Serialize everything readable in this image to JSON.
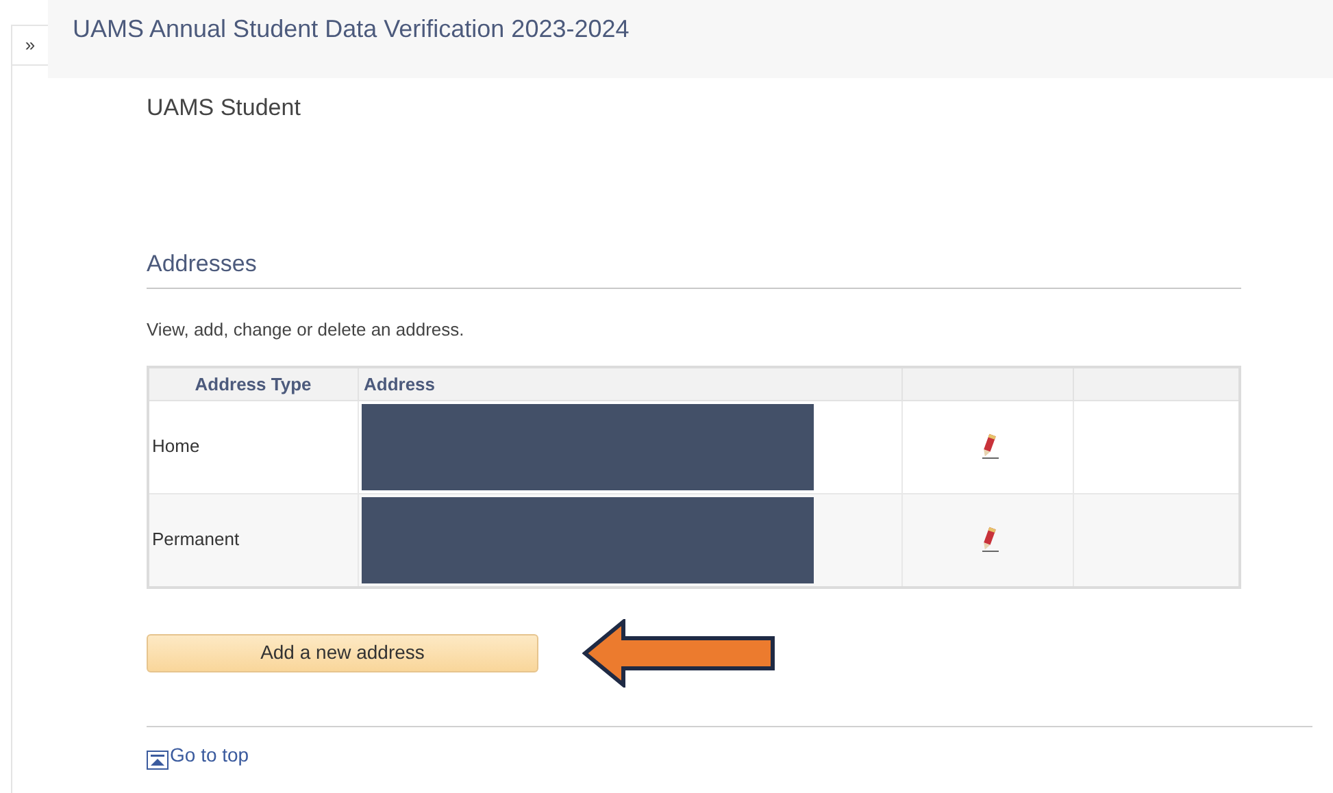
{
  "expand_button": {
    "label": "»"
  },
  "page_title": "UAMS Annual Student Data Verification 2023-2024",
  "subtitle": "UAMS Student",
  "section": {
    "heading": "Addresses",
    "description": "View, add, change or delete an address."
  },
  "table": {
    "columns": [
      "Address Type",
      "Address"
    ],
    "rows": [
      {
        "type": "Home"
      },
      {
        "type": "Permanent"
      }
    ]
  },
  "add_button": {
    "label": "Add a new address"
  },
  "go_to_top": {
    "label": "Go to top"
  }
}
